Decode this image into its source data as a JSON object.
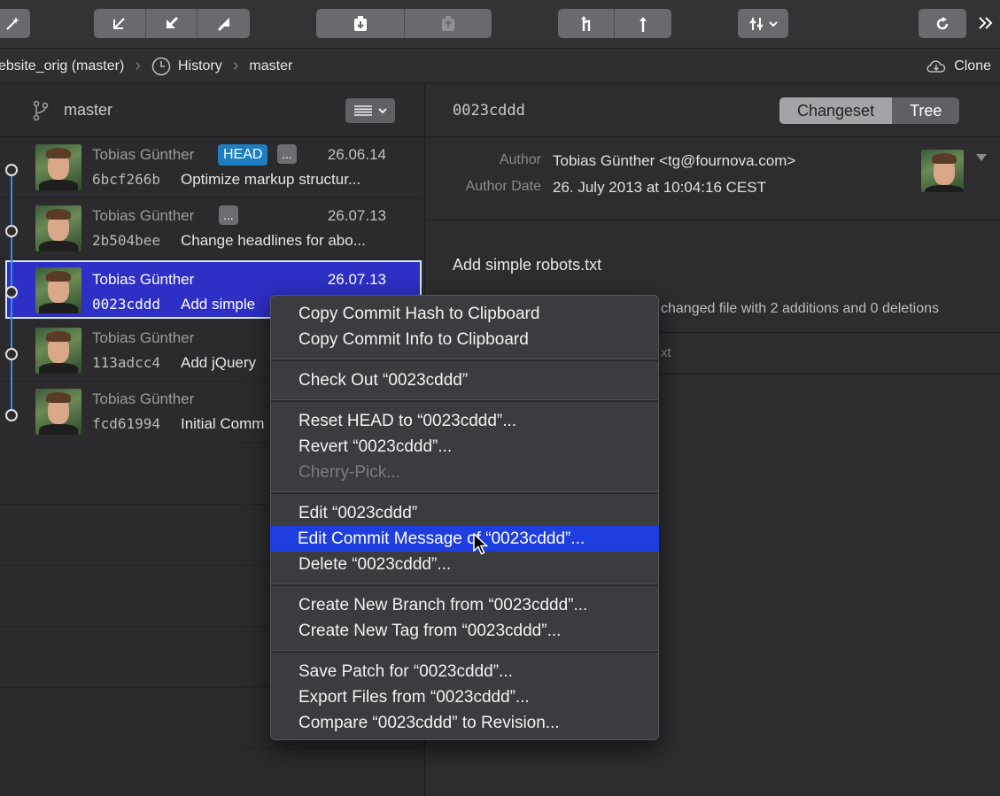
{
  "breadcrumb": {
    "repo": "ebsite_orig (master)",
    "history": "History",
    "branch": "master",
    "clone": "Clone"
  },
  "left": {
    "branch": "master",
    "commits": [
      {
        "author": "Tobias Günther",
        "date": "26.06.14",
        "hash": "6bcf266b",
        "message": "Optimize markup structur...",
        "head": "HEAD",
        "more": "..."
      },
      {
        "author": "Tobias Günther",
        "date": "26.07.13",
        "hash": "2b504bee",
        "message": "Change headlines for abo...",
        "more": "..."
      },
      {
        "author": "Tobias Günther",
        "date": "26.07.13",
        "hash": "0023cddd",
        "message": "Add simple"
      },
      {
        "author": "Tobias Günther",
        "date": "",
        "hash": "113adcc4",
        "message": "Add jQuery"
      },
      {
        "author": "Tobias Günther",
        "date": "",
        "hash": "fcd61994",
        "message": "Initial Comm"
      }
    ]
  },
  "right": {
    "commit_id": "0023cddd",
    "tabs": [
      "Changeset",
      "Tree"
    ],
    "author_label": "Author",
    "author_value": "Tobias Günther <tg@fournova.com>",
    "date_label": "Author Date",
    "date_value": "26. July 2013 at 10:04:16 CEST",
    "subject": "Add simple robots.txt",
    "summary": "changed file with 2 additions and 0 deletions",
    "partial_file": "xt"
  },
  "menu": {
    "groups": [
      [
        "Copy Commit Hash to Clipboard",
        "Copy Commit Info to Clipboard"
      ],
      [
        "Check Out “0023cddd”"
      ],
      [
        "Reset HEAD to “0023cddd”...",
        "Revert “0023cddd”...",
        "Cherry-Pick..."
      ],
      [
        "Edit “0023cddd”",
        "Edit Commit Message of “0023cddd”...",
        "Delete “0023cddd”..."
      ],
      [
        "Create New Branch from “0023cddd”...",
        "Create New Tag from “0023cddd”..."
      ],
      [
        "Save Patch for “0023cddd”...",
        "Export Files from “0023cddd”...",
        "Compare “0023cddd” to Revision..."
      ]
    ],
    "highlighted": "Edit Commit Message of “0023cddd”...",
    "disabled": [
      "Cherry-Pick..."
    ]
  },
  "colors": {
    "selection": "#2e2fc4",
    "menu_highlight": "#1e3ee0",
    "head_badge": "#1d7fc2",
    "graph": "#3a8ee8"
  }
}
